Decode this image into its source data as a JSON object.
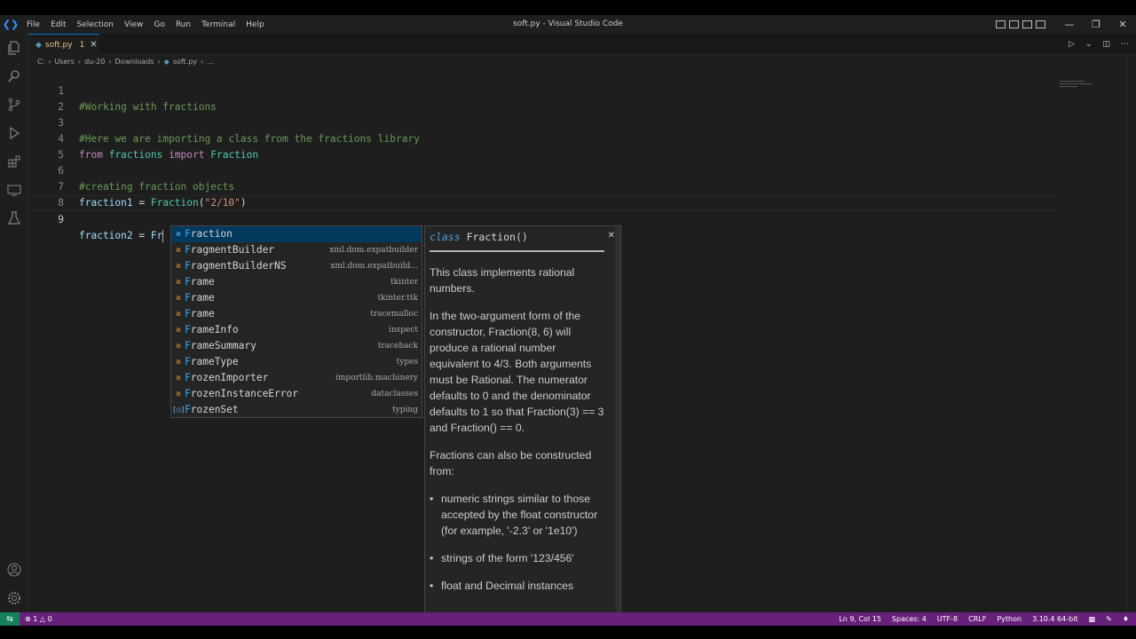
{
  "window": {
    "title": "soft.py - Visual Studio Code",
    "menu": [
      "File",
      "Edit",
      "Selection",
      "View",
      "Go",
      "Run",
      "Terminal",
      "Help"
    ]
  },
  "tab": {
    "name": "soft.py",
    "problems_count": "1"
  },
  "breadcrumb": [
    "C:",
    "Users",
    "du-20",
    "Downloads",
    "soft.py",
    "..."
  ],
  "editor": {
    "lines": [
      {
        "num": "1",
        "text": "#Working with fractions"
      },
      {
        "num": "2",
        "text": ""
      },
      {
        "num": "3",
        "text": "#Here we are importing a class from the fractions library"
      },
      {
        "num": "4",
        "kw1": "from",
        "mod": "fractions",
        "kw2": "import",
        "cls": "Fraction"
      },
      {
        "num": "5",
        "text": ""
      },
      {
        "num": "6",
        "text": "#creating fraction objects"
      },
      {
        "num": "7",
        "var": "fraction1",
        "op": " = ",
        "call": "Fraction",
        "arg": "\"2/10\""
      },
      {
        "num": "8",
        "text": ""
      },
      {
        "num": "9",
        "var": "fraction2",
        "op": " = ",
        "typed": "Fr"
      }
    ]
  },
  "suggest": {
    "items": [
      {
        "label_match": "F",
        "label_rest": "raction",
        "detail": ""
      },
      {
        "label_match": "F",
        "label_rest": "ragmentBuilder",
        "detail": "xml.dom.expatbuilder"
      },
      {
        "label_match": "F",
        "label_rest": "ragmentBuilderNS",
        "detail": "xml.dom.expatbuild..."
      },
      {
        "label_match": "F",
        "label_rest": "rame",
        "detail": "tkinter"
      },
      {
        "label_match": "F",
        "label_rest": "rame",
        "detail": "tkinter.ttk"
      },
      {
        "label_match": "F",
        "label_rest": "rame",
        "detail": "tracemalloc"
      },
      {
        "label_match": "F",
        "label_rest": "rameInfo",
        "detail": "inspect"
      },
      {
        "label_match": "F",
        "label_rest": "rameSummary",
        "detail": "traceback"
      },
      {
        "label_match": "F",
        "label_rest": "rameType",
        "detail": "types"
      },
      {
        "label_match": "F",
        "label_rest": "rozenImporter",
        "detail": "importlib.machinery"
      },
      {
        "label_match": "F",
        "label_rest": "rozenInstanceError",
        "detail": "dataclasses"
      },
      {
        "label_match": "F",
        "label_rest": "rozenSet",
        "detail": "typing"
      }
    ]
  },
  "docs": {
    "sig_keyword": "class",
    "sig_name": "Fraction()",
    "p1": "This class implements rational numbers.",
    "p2": "In the two-argument form of the constructor, Fraction(8, 6) will produce a rational number equivalent to 4/3. Both arguments must be Rational. The numerator defaults to 0 and the denominator defaults to 1 so that Fraction(3) == 3 and Fraction() == 0.",
    "p3": "Fractions can also be constructed from:",
    "b1": "numeric strings similar to those accepted by the float constructor (for example, '-2.3' or '1e10')",
    "b2": "strings of the form '123/456'",
    "b3": "float and Decimal instances"
  },
  "status": {
    "errors": "1",
    "warnings": "0",
    "position": "Ln 9, Col 15",
    "spaces": "Spaces: 4",
    "encoding": "UTF-8",
    "eol": "CRLF",
    "language": "Python",
    "interpreter": "3.10.4 64-bit"
  },
  "colors": {
    "statusbar": "#68217a",
    "accent": "#0078d4",
    "selection": "#04395e"
  }
}
